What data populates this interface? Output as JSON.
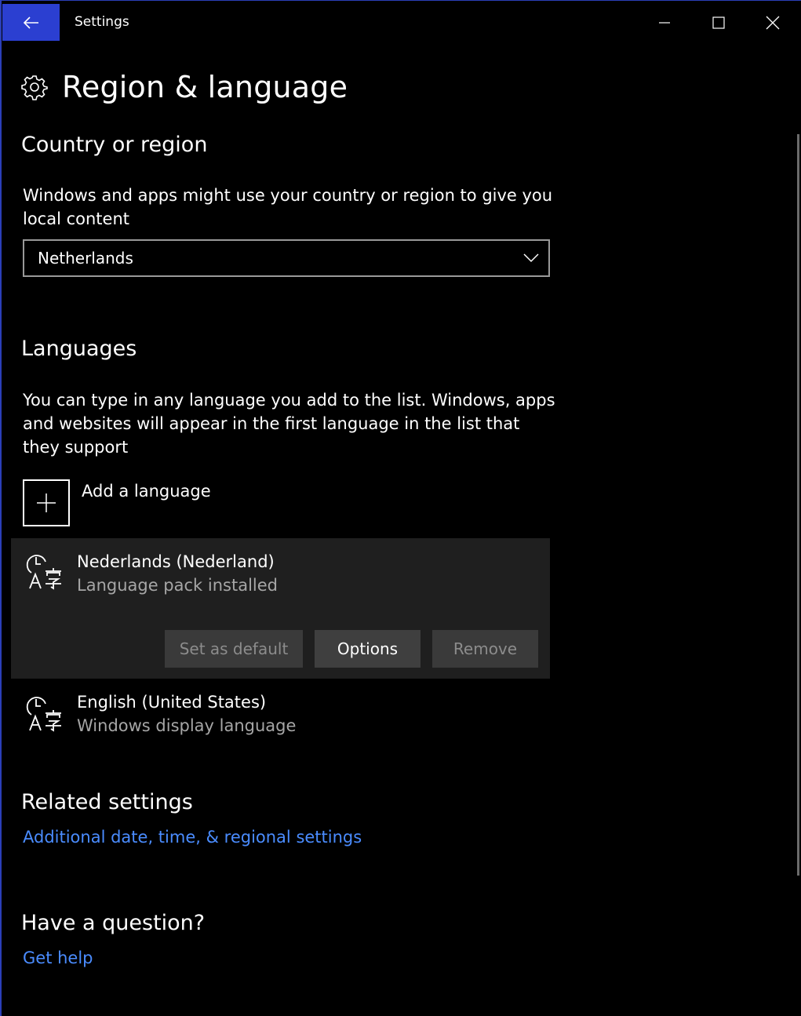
{
  "titlebar": {
    "title": "Settings",
    "back_icon": "arrow-left-icon",
    "accent": "#2b3fd1"
  },
  "page": {
    "title": "Region & language",
    "icon": "gear-icon"
  },
  "country": {
    "heading": "Country or region",
    "description": "Windows and apps might use your country or region to give you local content",
    "selected": "Netherlands"
  },
  "languages": {
    "heading": "Languages",
    "description": "You can type in any language you add to the list. Windows, apps and websites will appear in the first language in the list that they support",
    "add_label": "Add a language",
    "items": [
      {
        "name": "Nederlands (Nederland)",
        "status": "Language pack installed",
        "buttons": {
          "set_default": "Set as default",
          "options": "Options",
          "remove": "Remove"
        }
      },
      {
        "name": "English (United States)",
        "status": "Windows display language"
      }
    ]
  },
  "related": {
    "heading": "Related settings",
    "link": "Additional date, time, & regional settings"
  },
  "help": {
    "heading": "Have a question?",
    "link": "Get help"
  },
  "colors": {
    "background": "#000000",
    "link": "#4a8cff",
    "secondary_text": "#a6a6a6"
  }
}
